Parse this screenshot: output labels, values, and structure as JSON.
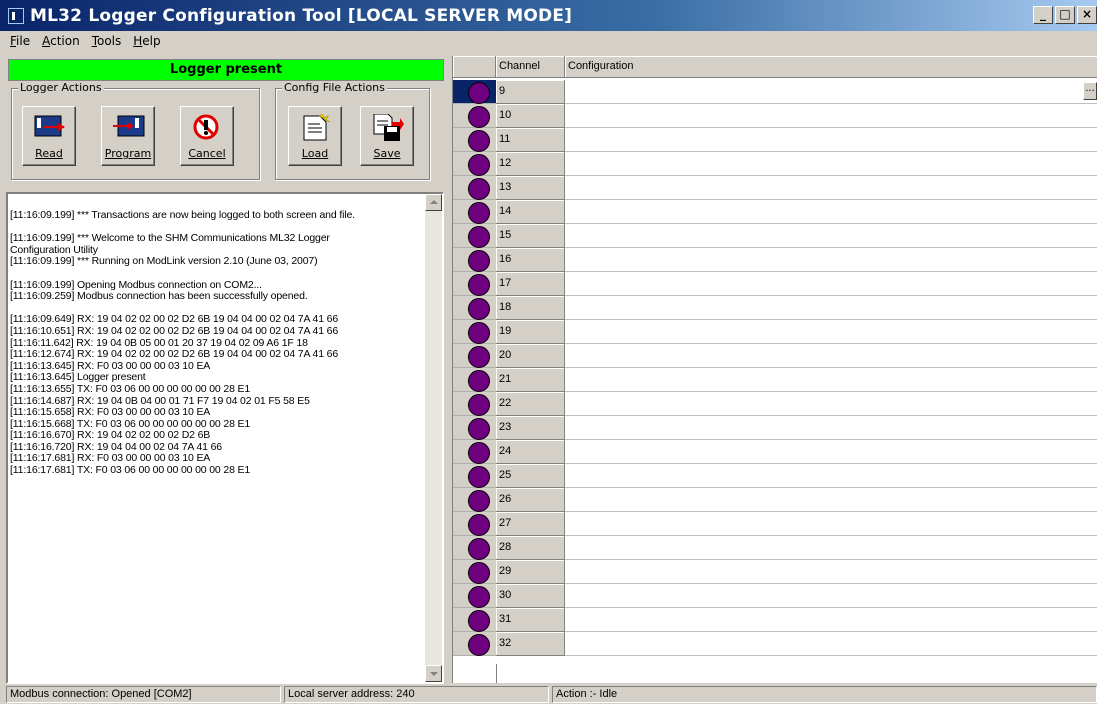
{
  "window": {
    "title": "ML32 Logger Configuration Tool [LOCAL SERVER MODE]",
    "min": "_",
    "max": "□",
    "close": "×"
  },
  "menu": [
    {
      "underline": "F",
      "rest": "ile"
    },
    {
      "underline": "A",
      "rest": "ction"
    },
    {
      "underline": "T",
      "rest": "ools"
    },
    {
      "underline": "H",
      "rest": "elp"
    }
  ],
  "status_banner": "Logger present",
  "logger_actions": {
    "title": "Logger Actions",
    "read": "Read",
    "program": "Program",
    "cancel": "Cancel"
  },
  "config_actions": {
    "title": "Config File Actions",
    "load": "Load",
    "save": "Save"
  },
  "log": "[11:16:09.199] *** Transactions are now being logged to both screen and file.\n\n[11:16:09.199] *** Welcome to the SHM Communications ML32 Logger\nConfiguration Utility\n[11:16:09.199] *** Running on ModLink version 2.10 (June 03, 2007)\n\n[11:16:09.199] Opening Modbus connection on COM2...\n[11:16:09.259] Modbus connection has been successfully opened.\n\n[11:16:09.649] RX: 19 04 02 02 00 02 D2 6B 19 04 04 00 02 04 7A 41 66\n[11:16:10.651] RX: 19 04 02 02 00 02 D2 6B 19 04 04 00 02 04 7A 41 66\n[11:16:11.642] RX: 19 04 0B 05 00 01 20 37 19 04 02 09 A6 1F 18\n[11:16:12.674] RX: 19 04 02 02 00 02 D2 6B 19 04 04 00 02 04 7A 41 66\n[11:16:13.645] RX: F0 03 00 00 00 03 10 EA\n[11:16:13.645] Logger present\n[11:16:13.655] TX: F0 03 06 00 00 00 00 00 00 28 E1\n[11:16:14.687] RX: 19 04 0B 04 00 01 71 F7 19 04 02 01 F5 58 E5\n[11:16:15.658] RX: F0 03 00 00 00 03 10 EA\n[11:16:15.668] TX: F0 03 06 00 00 00 00 00 00 28 E1\n[11:16:16.670] RX: 19 04 02 02 00 02 D2 6B\n[11:16:16.720] RX: 19 04 04 00 02 04 7A 41 66\n[11:16:17.681] RX: F0 03 00 00 00 03 10 EA\n[11:16:17.681] TX: F0 03 06 00 00 00 00 00 00 28 E1",
  "grid": {
    "col_channel": "Channel",
    "col_config": "Configuration",
    "ellipsis": "...",
    "channels": [
      "9",
      "10",
      "11",
      "12",
      "13",
      "14",
      "15",
      "16",
      "17",
      "18",
      "19",
      "20",
      "21",
      "22",
      "23",
      "24",
      "25",
      "26",
      "27",
      "28",
      "29",
      "30",
      "31",
      "32"
    ]
  },
  "statusbar": {
    "connection": "Modbus connection: Opened [COM2]",
    "server": "Local server address: 240",
    "action": "Action :- Idle"
  }
}
